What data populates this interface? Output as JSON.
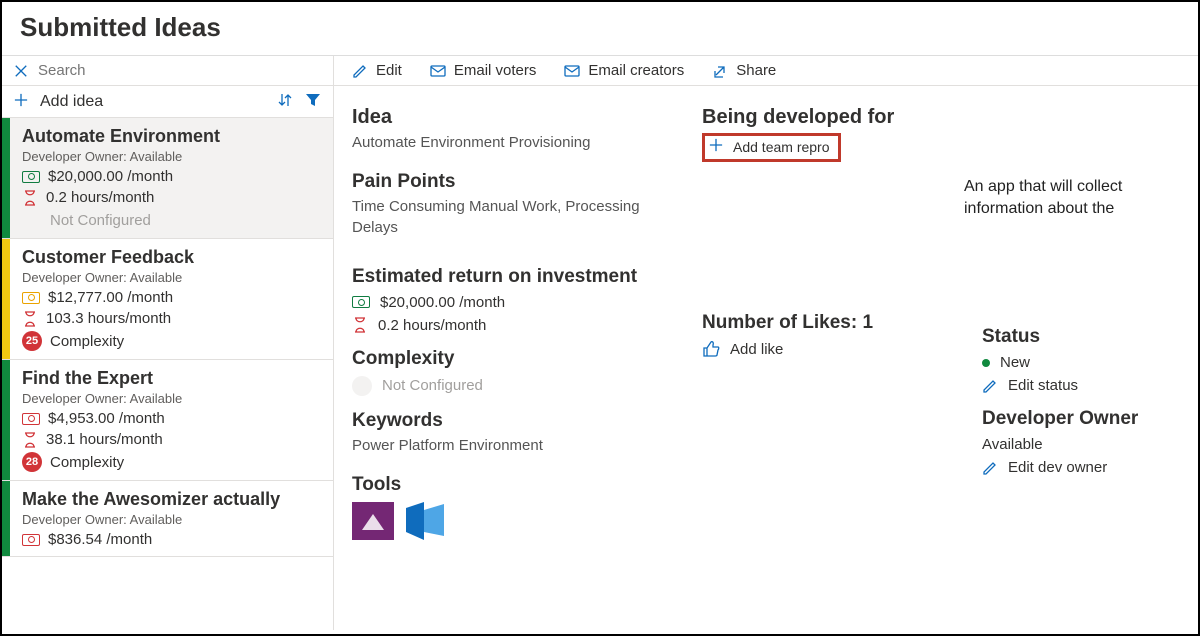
{
  "page": {
    "title": "Submitted Ideas"
  },
  "search": {
    "placeholder": "Search"
  },
  "addIdea": {
    "label": "Add idea"
  },
  "toolbar": {
    "edit": "Edit",
    "emailVoters": "Email voters",
    "emailCreators": "Email creators",
    "share": "Share"
  },
  "colors": {
    "green": "#10893e",
    "yellow": "#f2c811",
    "red": "#d83b01",
    "blue": "#0f6cbd",
    "redIcon": "#d13438",
    "greenIcon": "#107c41",
    "yellowIcon": "#eaa300"
  },
  "ideas": [
    {
      "accent": "green",
      "title": "Automate Environment",
      "owner": "Developer Owner: Available",
      "money": "$20,000.00 /month",
      "hours": "0.2 hours/month",
      "complexityLabel": "Not Configured",
      "complexityCount": "",
      "moneyColor": "greenIcon",
      "selected": true
    },
    {
      "accent": "yellow",
      "title": "Customer Feedback",
      "owner": "Developer Owner: Available",
      "money": "$12,777.00 /month",
      "hours": "103.3 hours/month",
      "complexityLabel": "Complexity",
      "complexityCount": "25",
      "moneyColor": "yellowIcon",
      "selected": false
    },
    {
      "accent": "green",
      "title": "Find the Expert",
      "owner": "Developer Owner: Available",
      "money": "$4,953.00 /month",
      "hours": "38.1 hours/month",
      "complexityLabel": "Complexity",
      "complexityCount": "28",
      "moneyColor": "redIcon",
      "selected": false
    },
    {
      "accent": "green",
      "title": "Make the Awesomizer actually",
      "owner": "Developer Owner: Available",
      "money": "$836.54 /month",
      "hours": "",
      "complexityLabel": "",
      "complexityCount": "",
      "moneyColor": "redIcon",
      "selected": false
    }
  ],
  "detail": {
    "ideaHead": "Idea",
    "ideaName": "Automate Environment Provisioning",
    "painHead": "Pain Points",
    "painText": "Time Consuming Manual Work, Processing Delays",
    "roiHead": "Estimated return on investment",
    "roiMoney": "$20,000.00 /month",
    "roiHours": "0.2 hours/month",
    "complexityHead": "Complexity",
    "complexityText": "Not Configured",
    "keywordsHead": "Keywords",
    "keywordsText": "Power Platform Environment",
    "toolsHead": "Tools",
    "devForHead": "Being developed for",
    "addTeamRepro": "Add team repro",
    "likesHead": "Number of Likes: 1",
    "addLike": "Add like",
    "statusHead": "Status",
    "statusValue": "New",
    "editStatus": "Edit status",
    "devOwnerHead": "Developer Owner",
    "devOwnerValue": "Available",
    "editDevOwner": "Edit dev owner",
    "annotation": "An app that will collect information about the"
  }
}
